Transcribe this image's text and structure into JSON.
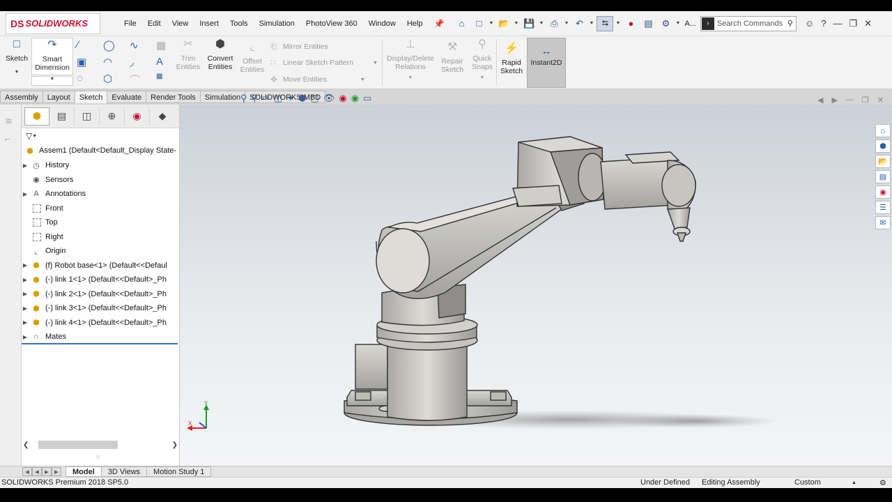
{
  "app": {
    "logo_ds": "DS",
    "logo_text": "SOLIDWORKS",
    "menu": [
      "File",
      "Edit",
      "View",
      "Insert",
      "Tools",
      "Simulation",
      "PhotoView 360",
      "Window",
      "Help"
    ],
    "search_placeholder": "Search Commands",
    "options_label": "A..."
  },
  "command_manager": {
    "sketch": "Sketch",
    "smart_dimension": "Smart Dimension",
    "trim_entities": "Trim Entities",
    "convert_entities": "Convert Entities",
    "offset_entities": "Offset Entities",
    "mirror_entities": "Mirror Entities",
    "linear_sketch_pattern": "Linear Sketch Pattern",
    "move_entities": "Move Entities",
    "display_delete_relations": "Display/Delete Relations",
    "repair_sketch": "Repair Sketch",
    "quick_snaps": "Quick Snaps",
    "rapid_sketch": "Rapid Sketch",
    "instant2d": "Instant2D"
  },
  "tabs": [
    "Assembly",
    "Layout",
    "Sketch",
    "Evaluate",
    "Render Tools",
    "Simulation",
    "SOLIDWORKS MBD"
  ],
  "active_tab": "Sketch",
  "feature_tree": {
    "root": "Assem1  (Default<Default_Display State-",
    "items": [
      {
        "label": "History",
        "icon": "history-icon",
        "expandable": true
      },
      {
        "label": "Sensors",
        "icon": "sensor-icon",
        "expandable": false
      },
      {
        "label": "Annotations",
        "icon": "annotation-icon",
        "expandable": true
      },
      {
        "label": "Front",
        "icon": "plane-icon",
        "expandable": false
      },
      {
        "label": "Top",
        "icon": "plane-icon",
        "expandable": false
      },
      {
        "label": "Right",
        "icon": "plane-icon",
        "expandable": false
      },
      {
        "label": "Origin",
        "icon": "origin-icon",
        "expandable": false
      },
      {
        "label": "(f) Robot base<1> (Default<<Defaul",
        "icon": "part-icon",
        "expandable": true
      },
      {
        "label": "(-) link 1<1> (Default<<Default>_Ph",
        "icon": "part-icon",
        "expandable": true
      },
      {
        "label": "(-) link 2<1> (Default<<Default>_Ph",
        "icon": "part-icon",
        "expandable": true
      },
      {
        "label": "(-) link 3<1> (Default<<Default>_Ph",
        "icon": "part-icon",
        "expandable": true
      },
      {
        "label": "(-) link 4<1> (Default<<Default>_Ph",
        "icon": "part-icon",
        "expandable": true
      },
      {
        "label": "Mates",
        "icon": "mates-icon",
        "expandable": true
      }
    ]
  },
  "triad": {
    "y": "Y",
    "x": "X"
  },
  "bottom_tabs": [
    "Model",
    "3D Views",
    "Motion Study 1"
  ],
  "active_bottom_tab": "Model",
  "status": {
    "product": "SOLIDWORKS Premium 2018 SP5.0",
    "definition": "Under Defined",
    "mode": "Editing Assembly",
    "units": "Custom"
  },
  "colors": {
    "brand_red": "#c8102e",
    "accent_blue": "#2f76c8",
    "part_yellow": "#d7a100"
  }
}
